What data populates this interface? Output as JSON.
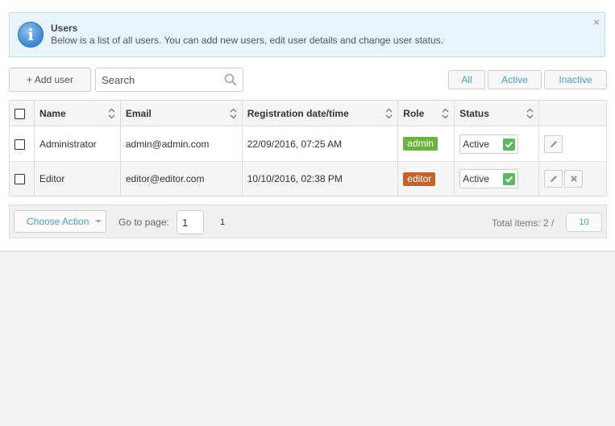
{
  "info": {
    "title": "Users",
    "text": "Below is a list of all users. You can add new users, edit user details and change user status.",
    "close": "×"
  },
  "toolbar": {
    "add_label": "+ Add user",
    "search_placeholder": "Search",
    "filters": {
      "all": "All",
      "active": "Active",
      "inactive": "Inactive"
    }
  },
  "table": {
    "headers": {
      "name": "Name",
      "email": "Email",
      "date": "Registration date/time",
      "role": "Role",
      "status": "Status"
    },
    "rows": [
      {
        "name": "Administrator",
        "email": "admin@admin.com",
        "date": "22/09/2016, 07:25 AM",
        "role": "admin",
        "role_color": "#6cb33e",
        "status": "Active"
      },
      {
        "name": "Editor",
        "email": "editor@editor.com",
        "date": "10/10/2016, 02:38 PM",
        "role": "editor",
        "role_color": "#c8622d",
        "status": "Active"
      }
    ]
  },
  "footer": {
    "choose_action": "Choose Action",
    "goto_label": "Go to page:",
    "page_value": "1",
    "page_number": "1",
    "total": "Total items: 2 /",
    "per_page": "10"
  },
  "colors": {
    "accent": "#4ba0c8",
    "check": "#5cb85c",
    "info_bg": "#e8f4fb"
  }
}
